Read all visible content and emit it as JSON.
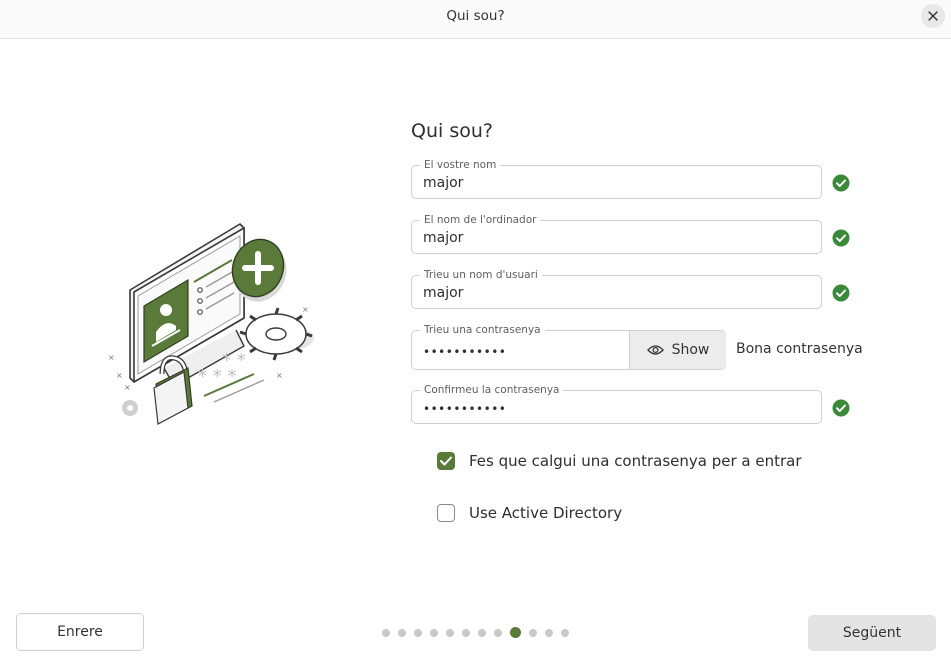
{
  "window": {
    "title": "Qui sou?",
    "close_icon": "close-icon"
  },
  "form": {
    "heading": "Qui sou?",
    "name": {
      "label": "El vostre nom",
      "value": "major",
      "valid": true
    },
    "computer_name": {
      "label": "El nom de l'ordinador",
      "value": "major",
      "valid": true
    },
    "username": {
      "label": "Trieu un nom d'usuari",
      "value": "major",
      "valid": true
    },
    "password": {
      "label": "Trieu una contrasenya",
      "value": "•••••••••••",
      "show_label": "Show",
      "strength": "Bona contrasenya"
    },
    "confirm_password": {
      "label": "Confirmeu la contrasenya",
      "value": "•••••••••••",
      "valid": true
    },
    "require_password": {
      "label": "Fes que calgui una contrasenya per a entrar",
      "checked": true
    },
    "active_directory": {
      "label": "Use Active Directory",
      "checked": false
    }
  },
  "footer": {
    "back_label": "Enrere",
    "next_label": "Següent",
    "progress": {
      "total_steps": 12,
      "current_step": 9
    }
  },
  "colors": {
    "accent": "#5a7a3a",
    "valid_check": "#3a8a3a"
  }
}
